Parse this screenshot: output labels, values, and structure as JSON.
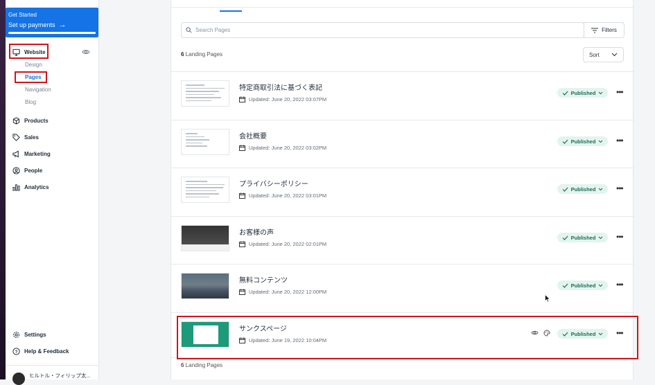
{
  "sidebar": {
    "promo": {
      "small": "Get Started",
      "title": "Set up payments",
      "arrow": "→"
    },
    "website": "Website",
    "design": "Design",
    "pages": "Pages",
    "navigation": "Navigation",
    "blog": "Blog",
    "products": "Products",
    "sales": "Sales",
    "marketing": "Marketing",
    "people": "People",
    "analytics": "Analytics",
    "settings": "Settings",
    "help": "Help & Feedback",
    "user": "ヒルトル・フィリップ太..."
  },
  "main": {
    "search_placeholder": "Search Pages",
    "filters_label": "Filters",
    "count_num": "6",
    "count_label": " Landing Pages",
    "sort_label": "Sort",
    "status_label": "Published",
    "more_label": "•••",
    "pages": [
      {
        "title": "特定商取引法に基づく表記",
        "updated": "Updated: June 20, 2022 03:07PM"
      },
      {
        "title": "会社概要",
        "updated": "Updated: June 20, 2022 03:02PM"
      },
      {
        "title": "プライバシーポリシー",
        "updated": "Updated: June 20, 2022 03:01PM"
      },
      {
        "title": "お客様の声",
        "updated": "Updated: June 20, 2022 02:01PM"
      },
      {
        "title": "無料コンテンツ",
        "updated": "Updated: June 20, 2022 12:00PM"
      },
      {
        "title": "サンクスページ",
        "updated": "Updated: June 19, 2022 10:04PM"
      }
    ]
  },
  "colors": {
    "accent": "#1573e6",
    "highlight": "#d0141c",
    "published_bg": "#e3f4ee"
  }
}
